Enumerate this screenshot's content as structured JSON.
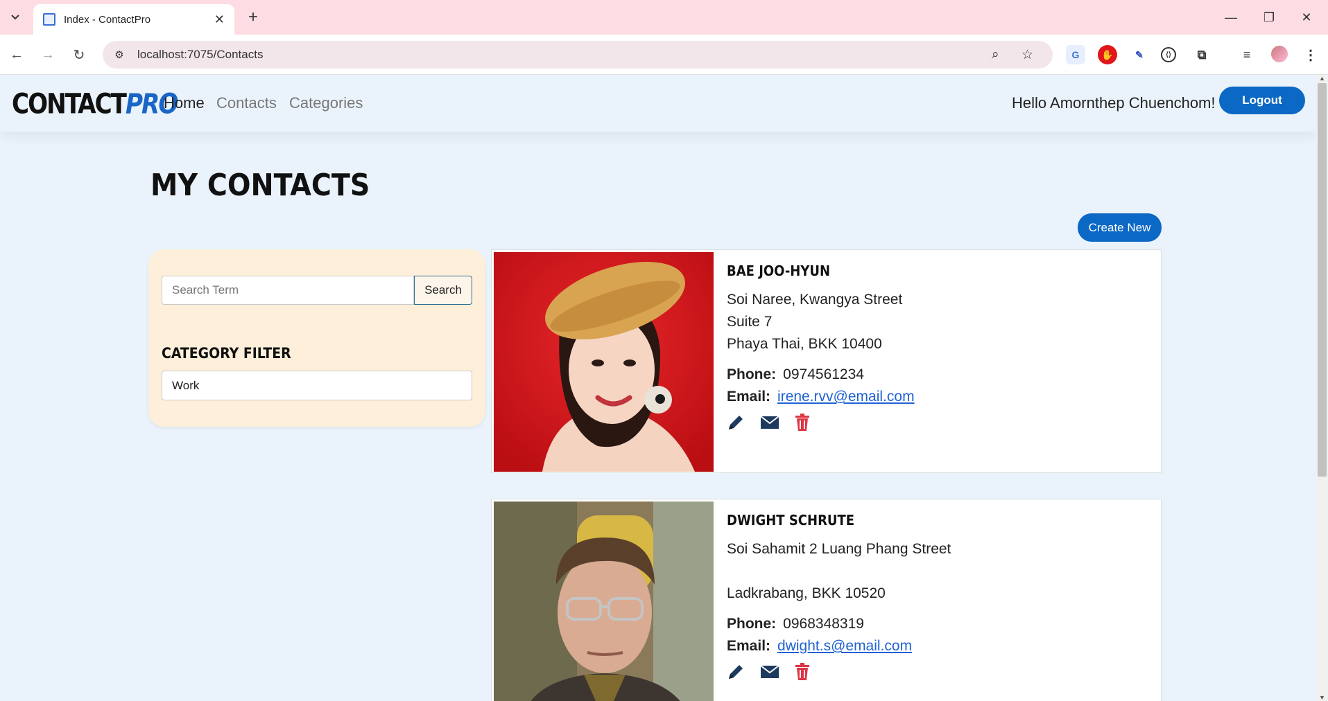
{
  "browser": {
    "tab_title": "Index - ContactPro",
    "url": "localhost:7075/Contacts"
  },
  "navbar": {
    "brand_part1": "CONTACT",
    "brand_part2": "PRO",
    "links": [
      {
        "label": "Home"
      },
      {
        "label": "Contacts"
      },
      {
        "label": "Categories"
      }
    ],
    "greeting": "Hello Amornthep Chuenchom!",
    "logout_label": "Logout"
  },
  "page": {
    "title": "MY CONTACTS",
    "create_label": "Create New"
  },
  "filter": {
    "search_placeholder": "Search Term",
    "search_button": "Search",
    "category_heading": "CATEGORY FILTER",
    "category_selected": "Work"
  },
  "contacts": [
    {
      "name": "BAE JOO-HYUN",
      "address1": "Soi Naree, Kwangya Street",
      "address2": "Suite 7",
      "city_line": "Phaya Thai, BKK 10400",
      "phone_label": "Phone:",
      "phone": "0974561234",
      "email_label": "Email:",
      "email": "irene.rvv@email.com"
    },
    {
      "name": "DWIGHT SCHRUTE",
      "address1": "Soi Sahamit 2 Luang Phang Street",
      "address2": "",
      "city_line": "Ladkrabang, BKK 10520",
      "phone_label": "Phone:",
      "phone": "0968348319",
      "email_label": "Email:",
      "email": "dwight.s@email.com"
    }
  ],
  "colors": {
    "primary": "#0b68c4",
    "page_bg": "#eaf3fb",
    "filter_bg": "#fdefd9",
    "delete_icon": "#dc3545",
    "edit_icon": "#1e3a5f"
  }
}
